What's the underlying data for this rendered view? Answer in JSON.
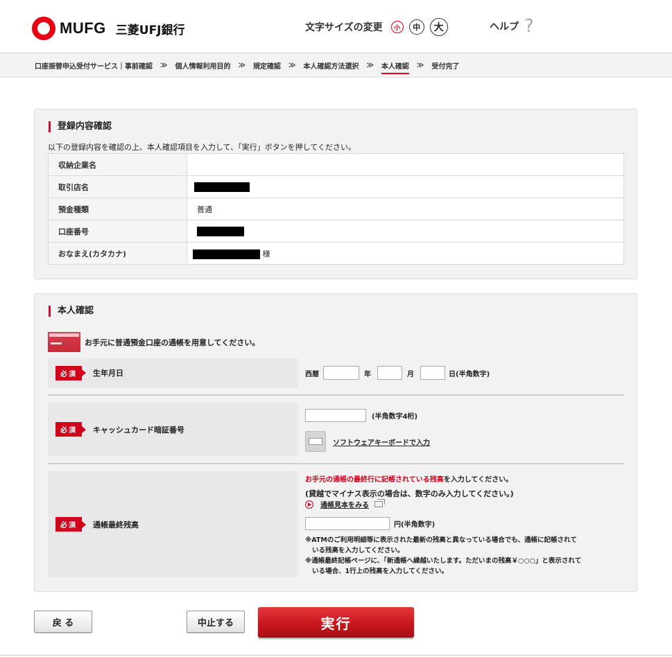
{
  "header": {
    "logo_text": "MUFG",
    "bank_name": "三菱UFJ銀行",
    "font_size_label": "文字サイズの変更",
    "font_size_small": "小",
    "font_size_medium": "中",
    "font_size_large": "大",
    "help_label": "ヘルプ",
    "help_icon": "?"
  },
  "breadcrumb": {
    "separator": "≫",
    "items": [
      "口座振替申込受付サービス｜事前確認",
      "個人情報利用目的",
      "規定確認",
      "本人確認方法選択",
      "本人確認",
      "受付完了"
    ],
    "current_index": 4
  },
  "registration": {
    "title": "登録内容確認",
    "description": "以下の登録内容を確認の上、本人確認項目を入力して、「実行」ボタンを押してください。",
    "rows": [
      {
        "label": "収納企業名",
        "value": ""
      },
      {
        "label": "取引店名",
        "value": ""
      },
      {
        "label": "預金種類",
        "value": "普通"
      },
      {
        "label": "口座番号",
        "value": ""
      },
      {
        "label": "おなまえ(カタカナ)",
        "value": "",
        "suffix": "様"
      }
    ]
  },
  "identity": {
    "title": "本人確認",
    "passbook_note": "お手元に普通預金口座の通帳を用意してください。",
    "required_badge": "必須",
    "birth": {
      "label": "生年月日",
      "era": "西暦",
      "year_unit": "年",
      "month_unit": "月",
      "day_unit": "日(半角数字)"
    },
    "pin": {
      "label": "キャッシュカード暗証番号",
      "hint": "(半角数字4桁)",
      "keyboard_link": "ソフトウェアキーボードで入力"
    },
    "balance": {
      "label": "通帳最終残高",
      "instruction_red": "お手元の通帳の最終行に記帳されている残高",
      "instruction_rest": "を入力してください。",
      "overdraft_note": "(貸越でマイナス表示の場合は、数字のみ入力してください。)",
      "sample_link": "通帳見本をみる",
      "unit": "円(半角数字)",
      "note1_line1": "※ATMのご利用明細等に表示された最新の残高と異なっている場合でも、通帳に記帳されて",
      "note1_line2": "いる残高を入力してください。",
      "note2_line1": "※通帳最終記帳ページに、「新通帳へ繰越いたします。ただいまの残高￥○○○」と表示されて",
      "note2_line2": "いる場合、1行上の残高を入力してください。"
    }
  },
  "buttons": {
    "back": "戻 る",
    "cancel": "中止する",
    "execute": "実行"
  },
  "colors": {
    "brand_red": "#e60012",
    "required_red": "#d0021b",
    "execute_red": "#c8161d"
  }
}
